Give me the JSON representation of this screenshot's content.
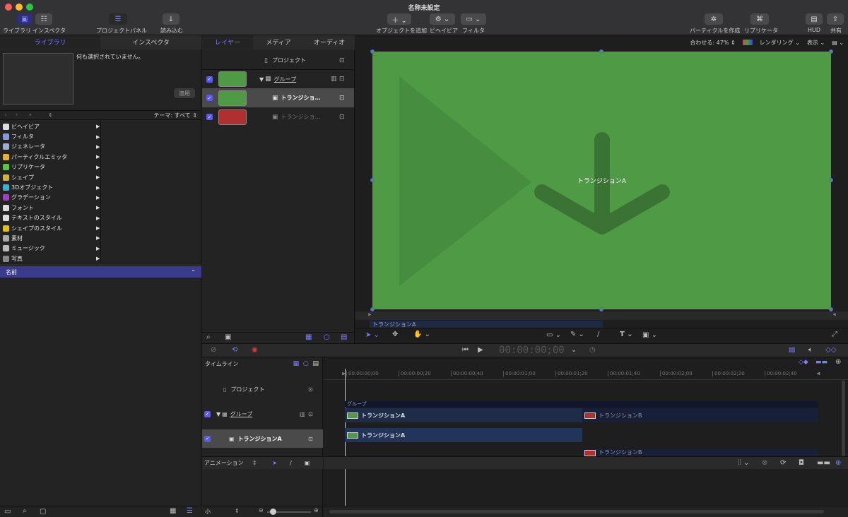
{
  "window": {
    "title": "名称未設定"
  },
  "toolbar": {
    "library_label": "ライブラリ",
    "inspector_label": "インスペクタ",
    "project_panel_label": "プロジェクトパネル",
    "import_label": "読み込む",
    "add_object_label": "オブジェクトを追加",
    "behavior_label": "ビヘイビア",
    "filter_label": "フィルタ",
    "make_particles_label": "パーティクルを作成",
    "replicator_label": "リプリケータ",
    "hud_label": "HUD",
    "share_label": "共有"
  },
  "left_panel": {
    "tabs": [
      "ライブラリ",
      "インスペクタ"
    ],
    "preview_text": "何も選択されていません。",
    "apply_label": "適用",
    "theme_label": "テーマ: すべて",
    "category_dash": "-",
    "categories": [
      {
        "label": "ビヘイビア",
        "icon": "behavior-icon",
        "color": "#dddddd"
      },
      {
        "label": "フィルタ",
        "icon": "filter-icon",
        "color": "#8a9ad8"
      },
      {
        "label": "ジェネレータ",
        "icon": "generator-icon",
        "color": "#9ab0d0"
      },
      {
        "label": "パーティクルエミッタ",
        "icon": "particle-icon",
        "color": "#e0b040"
      },
      {
        "label": "リプリケータ",
        "icon": "replicator-icon",
        "color": "#60c050"
      },
      {
        "label": "シェイプ",
        "icon": "shape-icon",
        "color": "#d0b040"
      },
      {
        "label": "3Dオブジェクト",
        "icon": "3d-object-icon",
        "color": "#40b0d0"
      },
      {
        "label": "グラデーション",
        "icon": "gradient-icon",
        "color": "#a040c0"
      },
      {
        "label": "フォント",
        "icon": "font-icon",
        "color": "#dddddd"
      },
      {
        "label": "テキストのスタイル",
        "icon": "text-style-icon",
        "color": "#dddddd"
      },
      {
        "label": "シェイプのスタイル",
        "icon": "shape-style-icon",
        "color": "#e0c020"
      },
      {
        "label": "素材",
        "icon": "material-icon",
        "color": "#aaaaaa"
      },
      {
        "label": "ミュージック",
        "icon": "music-icon",
        "color": "#bbbbbb"
      },
      {
        "label": "写真",
        "icon": "photo-icon",
        "color": "#888888"
      }
    ],
    "list_header": "名前"
  },
  "layers_panel": {
    "tabs": [
      "レイヤー",
      "メディア",
      "オーディオ"
    ],
    "project_label": "プロジェクト",
    "rows": [
      {
        "label": "グループ",
        "thumb_color": "#4e9a45"
      },
      {
        "label": "トランジショ…",
        "thumb_color": "#4e9a45"
      },
      {
        "label": "トランジショ…",
        "thumb_color": "#b03030"
      }
    ]
  },
  "canvas": {
    "fit_label": "合わせる: 47%",
    "render_label": "レンダリング",
    "view_label": "表示",
    "bg_color": "#4e9a45",
    "title_text": "トランジションA",
    "mini_label": "トランジションA"
  },
  "transport": {
    "timecode": "00:00:00;00"
  },
  "timeline": {
    "header_label": "タイムライン",
    "project_label": "プロジェクト",
    "group_label": "グループ",
    "layer_label": "トランジションA",
    "ruler": [
      "00:00:00;00",
      "00:00:00;20",
      "00:00:00;40",
      "00:00:01;00",
      "00:00:01;20",
      "00:00:01;40",
      "00:00:02;00",
      "00:00:02;20",
      "00:00:02;40"
    ],
    "group_bar_label": "グループ",
    "clip_a_label": "トランジションA",
    "clip_b_label": "トランジションB",
    "animation_label": "アニメーション",
    "size_label": "小"
  }
}
